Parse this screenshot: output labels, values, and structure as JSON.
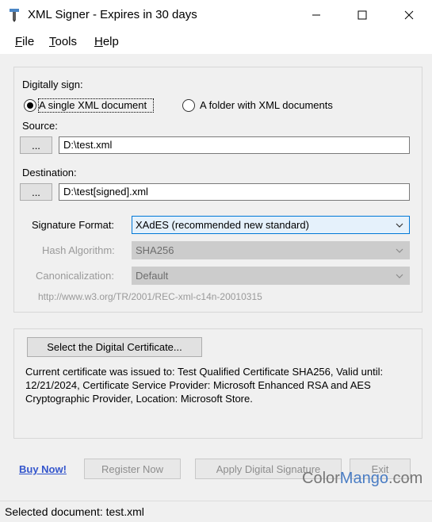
{
  "window": {
    "title": "XML Signer - Expires in 30 days"
  },
  "menu": {
    "file": {
      "underline": "F",
      "rest": "ile"
    },
    "tools": {
      "underline": "T",
      "rest": "ools"
    },
    "help": {
      "underline": "H",
      "rest": "elp"
    }
  },
  "sign": {
    "label": "Digitally sign:",
    "option_single": "A single XML document",
    "option_folder": "A folder with XML documents",
    "selected": "single"
  },
  "source": {
    "label": "Source:",
    "browse_label": "...",
    "value": "D:\\test.xml"
  },
  "destination": {
    "label": "Destination:",
    "browse_label": "...",
    "value": "D:\\test[signed].xml"
  },
  "format": {
    "label": "Signature Format:",
    "value": "XAdES (recommended new standard)"
  },
  "hash": {
    "label": "Hash Algorithm:",
    "value": "SHA256"
  },
  "canon": {
    "label": "Canonicalization:",
    "value": "Default",
    "uri": "http://www.w3.org/TR/2001/REC-xml-c14n-20010315"
  },
  "certificate": {
    "select_label": "Select the Digital Certificate...",
    "info": "Current certificate was issued to: Test Qualified Certificate SHA256, Valid until: 12/21/2024, Certificate Service Provider: Microsoft Enhanced RSA and AES Cryptographic Provider, Location: Microsoft Store."
  },
  "actions": {
    "buy": "Buy Now!",
    "register": "Register Now",
    "apply": "Apply Digital Signature",
    "exit": "Exit"
  },
  "watermark": {
    "part1": "Color",
    "part2": "Mango",
    "part3": ".com"
  },
  "status": {
    "text": "Selected document: test.xml"
  },
  "colors": {
    "accent": "#0078d7",
    "link": "#3355cc"
  }
}
